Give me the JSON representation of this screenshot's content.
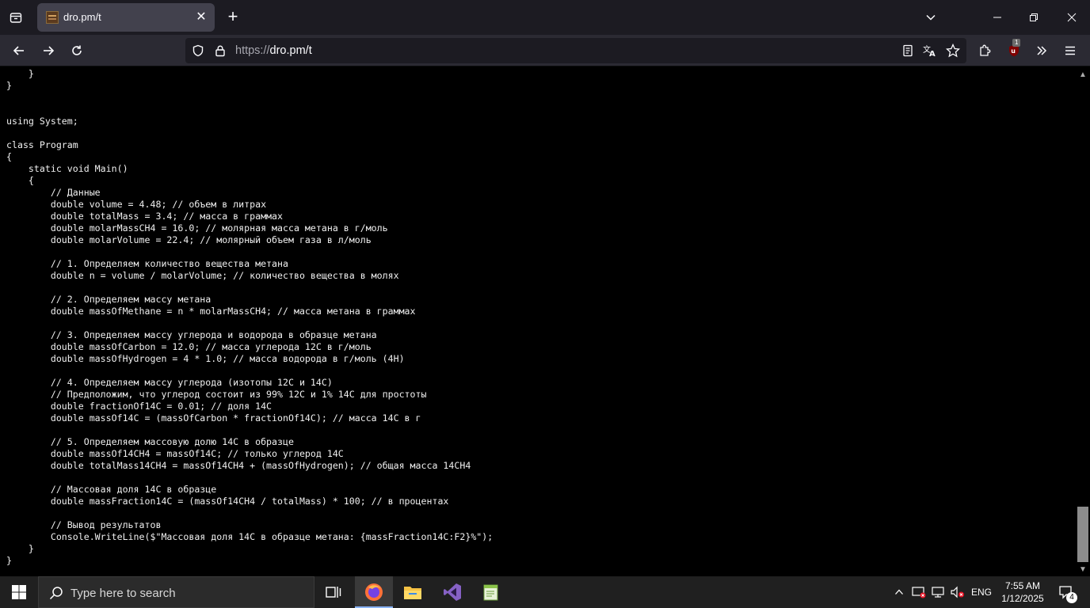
{
  "browser": {
    "tab_title": "dro.pm/t",
    "url_scheme": "https://",
    "url_host": "dro.pm/t",
    "extension_badge": "1"
  },
  "page": {
    "code_lines": [
      "    }",
      "}",
      "",
      "",
      "using System;",
      "",
      "class Program",
      "{",
      "    static void Main()",
      "    {",
      "        // Данные",
      "        double volume = 4.48; // объем в литрах",
      "        double totalMass = 3.4; // масса в граммах",
      "        double molarMassCH4 = 16.0; // молярная масса метана в г/моль",
      "        double molarVolume = 22.4; // молярный объем газа в л/моль",
      "",
      "        // 1. Определяем количество вещества метана",
      "        double n = volume / molarVolume; // количество вещества в молях",
      "",
      "        // 2. Определяем массу метана",
      "        double massOfMethane = n * molarMassCH4; // масса метана в граммах",
      "",
      "        // 3. Определяем массу углерода и водорода в образце метана",
      "        double massOfCarbon = 12.0; // масса углерода 12C в г/моль",
      "        double massOfHydrogen = 4 * 1.0; // масса водорода в г/моль (4H)",
      "",
      "        // 4. Определяем массу углерода (изотопы 12C и 14C)",
      "        // Предположим, что углерод состоит из 99% 12C и 1% 14C для простоты",
      "        double fractionOf14C = 0.01; // доля 14C",
      "        double massOf14C = (massOfCarbon * fractionOf14C); // масса 14C в г",
      "",
      "        // 5. Определяем массовую долю 14C в образце",
      "        double massOf14CH4 = massOf14C; // только углерод 14C",
      "        double totalMass14CH4 = massOf14CH4 + (massOfHydrogen); // общая масса 14CH4",
      "",
      "        // Массовая доля 14C в образце",
      "        double massFraction14C = (massOf14CH4 / totalMass) * 100; // в процентах",
      "",
      "        // Вывод результатов",
      "        Console.WriteLine($\"Массовая доля 14C в образце метана: {massFraction14C:F2}%\");",
      "    }",
      "}"
    ]
  },
  "taskbar": {
    "search_placeholder": "Type here to search",
    "apps": [
      "task-view-icon",
      "firefox-icon",
      "file-explorer-icon",
      "visual-studio-icon",
      "notepad-plus-plus-icon"
    ],
    "language": "ENG",
    "time": "7:55 AM",
    "date": "1/12/2025",
    "notification_count": "4"
  },
  "colors": {
    "tabbar_bg": "#1c1b22",
    "navbar_bg": "#2b2a33",
    "page_bg": "#000000",
    "taskbar_bg": "#202020",
    "accent": "#8ab4f8"
  }
}
